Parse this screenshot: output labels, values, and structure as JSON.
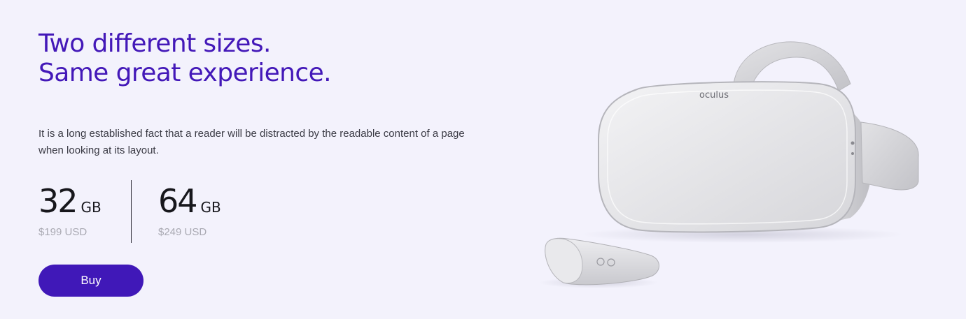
{
  "hero": {
    "headline_line1": "Two different sizes.",
    "headline_line2": "Same great experience.",
    "description": "It is a long established fact that a reader will be distracted by the readable content of a page when looking at its layout.",
    "plans": [
      {
        "size": "32",
        "unit": "GB",
        "price": "$199 USD"
      },
      {
        "size": "64",
        "unit": "GB",
        "price": "$249 USD"
      }
    ],
    "buy_label": "Buy"
  },
  "product": {
    "brand_text": "oculus"
  },
  "colors": {
    "background": "#f3f2fc",
    "headline": "#4318b8",
    "button": "#4018b8",
    "price": "#a9a9b2"
  }
}
